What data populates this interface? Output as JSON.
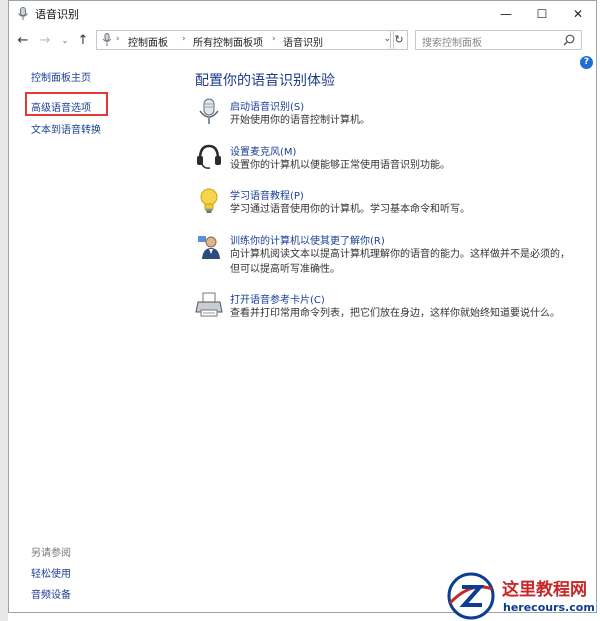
{
  "window": {
    "title": "语音识别",
    "buttons": {
      "minimize": "—",
      "maximize": "☐",
      "close": "✕"
    }
  },
  "navigation": {
    "back": "←",
    "forward": "→",
    "recent": "⌄",
    "up": "↑",
    "breadcrumb": [
      "控制面板",
      "所有控制面板项",
      "语音识别"
    ],
    "separator": "›",
    "refresh": "↻",
    "search_placeholder": "搜索控制面板"
  },
  "help": "?",
  "sidebar": {
    "home": "控制面板主页",
    "links": [
      "高级语音选项",
      "文本到语音转换"
    ],
    "see_also_title": "另请参阅",
    "see_also_links": [
      "轻松使用",
      "音频设备"
    ]
  },
  "main": {
    "heading": "配置你的语音识别体验",
    "items": [
      {
        "link": "启动语音识别(S)",
        "description": "开始使用你的语音控制计算机。",
        "icon": "microphone-icon"
      },
      {
        "link": "设置麦克风(M)",
        "description": "设置你的计算机以便能够正常使用语音识别功能。",
        "icon": "headset-icon"
      },
      {
        "link": "学习语音教程(P)",
        "description": "学习通过语音使用你的计算机。学习基本命令和听写。",
        "icon": "lightbulb-icon"
      },
      {
        "link": "训练你的计算机以使其更了解你(R)",
        "description": "向计算机阅读文本以提高计算机理解你的语音的能力。这样做并不是必须的，但可以提高听写准确性。",
        "icon": "user-training-icon"
      },
      {
        "link": "打开语音参考卡片(C)",
        "description": "查看并打印常用命令列表，把它们放在身边，这样你就始终知道要说什么。",
        "icon": "printer-icon"
      }
    ]
  },
  "watermark": {
    "name": "这里教程网",
    "url": "herecours.com"
  },
  "colors": {
    "link": "#1c3f94",
    "heading": "#1e3a8a",
    "highlight_box": "#e53935",
    "help": "#1e6fd0"
  }
}
